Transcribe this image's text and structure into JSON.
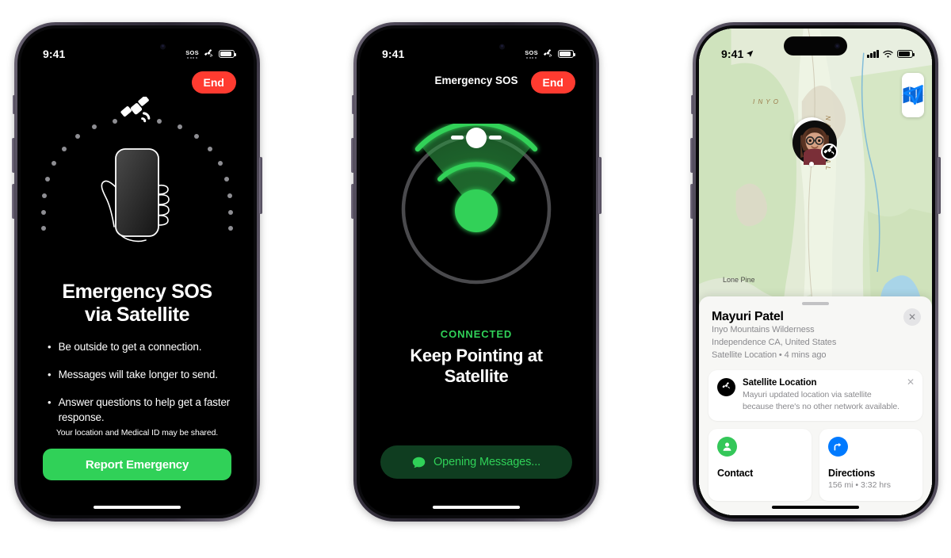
{
  "phones": [
    {
      "id": "emergency-sos-intro",
      "status_bar": {
        "time": "9:41",
        "sos_label": "SOS",
        "satellite_icon": "satellite-icon",
        "battery_icon": "battery-icon"
      },
      "end_button": "End",
      "illustration": {
        "satellite_icon": "satellite-icon",
        "hand_icon": "hand-holding-phone-icon",
        "arc": "dotted-arc"
      },
      "title_line1": "Emergency SOS",
      "title_line2": "via Satellite",
      "bullets": [
        "Be outside to get a connection.",
        "Messages will take longer to send.",
        "Answer questions to help get a faster response."
      ],
      "disclaimer": "Your location and Medical ID may be shared.",
      "cta_label": "Report Emergency",
      "cta_color": "#30d158"
    },
    {
      "id": "emergency-sos-pointing",
      "status_bar": {
        "time": "9:41",
        "sos_label": "SOS",
        "satellite_icon": "satellite-icon",
        "battery_icon": "battery-icon"
      },
      "nav_title": "Emergency SOS",
      "end_button": "End",
      "status_label": "CONNECTED",
      "status_color": "#30d158",
      "headline_line1": "Keep Pointing at",
      "headline_line2": "Satellite",
      "action_button": {
        "label": "Opening Messages...",
        "icon": "message-bubble-icon",
        "color": "#30d158"
      }
    },
    {
      "id": "maps-satellite-location",
      "status_bar": {
        "time": "9:41",
        "location_icon": "location-arrow-icon",
        "cellular_icon": "cellular-bars-icon",
        "wifi_icon": "wifi-icon",
        "battery_icon": "battery-icon"
      },
      "map": {
        "labels": [
          {
            "text": "Lone Pine",
            "kind": "place"
          },
          {
            "text": "I N Y O",
            "kind": "park"
          },
          {
            "text": "N A T I O N A L",
            "kind": "park"
          }
        ],
        "controls": [
          {
            "name": "map-mode-button",
            "icon": "map-book-icon"
          },
          {
            "name": "locate-me-button",
            "icon": "location-arrow-icon"
          }
        ],
        "pin": {
          "avatar": "memoji-avatar",
          "badge_icon": "satellite-icon"
        }
      },
      "card": {
        "name": "Mayuri Patel",
        "sub1": "Inyo Mountains Wilderness",
        "sub2": "Independence CA, United States",
        "sub3": "Satellite Location • 4 mins ago",
        "close_icon": "close-icon"
      },
      "notice": {
        "icon": "satellite-icon",
        "title": "Satellite Location",
        "body": "Mayuri updated location via satellite because there's no other network available.",
        "close_icon": "close-icon"
      },
      "actions": [
        {
          "label": "Contact",
          "sub": "",
          "icon": "person-icon",
          "color": "#34c759"
        },
        {
          "label": "Directions",
          "sub": "156 mi • 3:32 hrs",
          "icon": "directions-arrow-icon",
          "color": "#007aff"
        }
      ]
    }
  ]
}
